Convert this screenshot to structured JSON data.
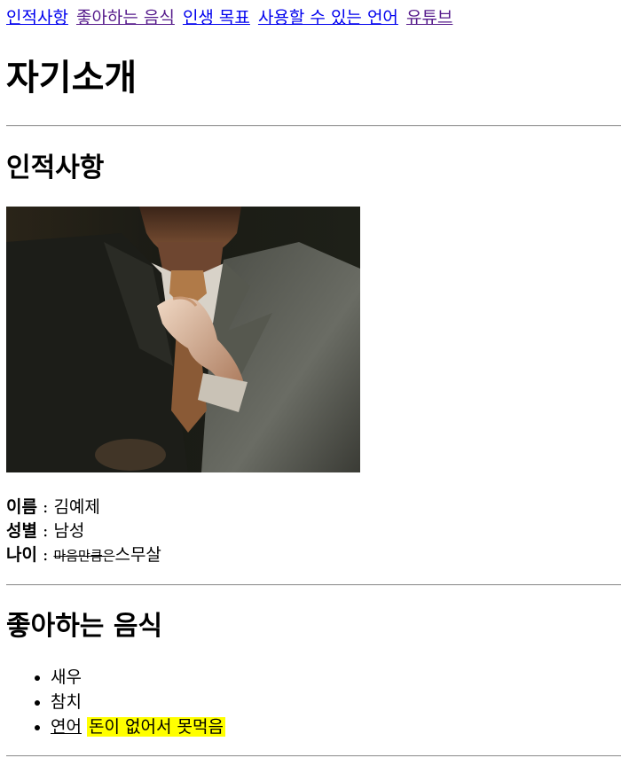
{
  "nav": {
    "links": [
      {
        "label": "인적사항"
      },
      {
        "label": "좋아하는 음식"
      },
      {
        "label": "인생 목표"
      },
      {
        "label": "사용할 수 있는 언어"
      },
      {
        "label": "유튜브"
      }
    ]
  },
  "title": "자기소개",
  "profile": {
    "heading": "인적사항",
    "name_label": "이름",
    "name_value": "김예제",
    "gender_label": "성별",
    "gender_value": "남성",
    "age_label": "나이",
    "age_struck": "마음만큼은",
    "age_value": "스무살",
    "separator": " : "
  },
  "foods": {
    "heading": "좋아하는 음식",
    "items": [
      "새우",
      "참치"
    ],
    "linked_item": "연어",
    "highlight_note": "돈이 없어서 못먹음"
  },
  "colors": {
    "link": "#0000ee",
    "visited_link": "#551a8b",
    "highlight": "#ffff00"
  }
}
